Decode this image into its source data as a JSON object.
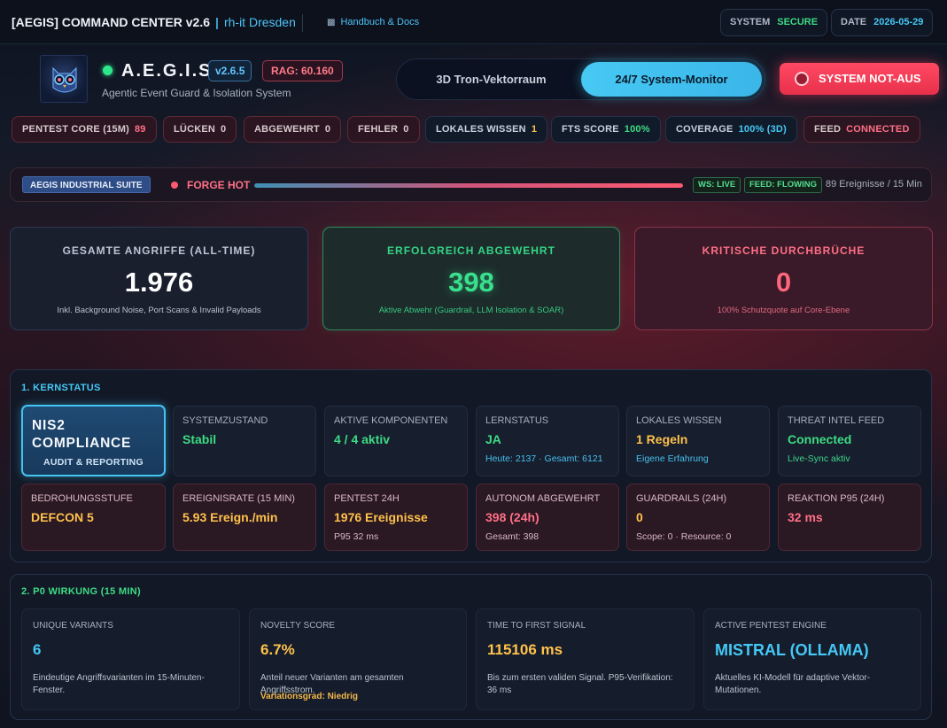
{
  "topbar": {
    "title": "[AEGIS] COMMAND CENTER v2.6",
    "separator": "|",
    "org": "rh-it Dresden",
    "docs_icon": "book-icon",
    "docs_label": "Handbuch & Docs",
    "system_label": "SYSTEM",
    "system_value": "SECURE",
    "date_label": "DATE",
    "date_value": "2026-05-29"
  },
  "header": {
    "logo": "owl-logo",
    "brand": "A.E.G.I.S.",
    "subtitle": "Agentic Event Guard & Isolation System",
    "version": "v2.6.5",
    "rag": "RAG: 60.160",
    "modes": [
      "3D Tron-Vektorraum",
      "24/7 System-Monitor"
    ],
    "active_mode": "24/7 System-Monitor",
    "emergency_label": "SYSTEM NOT-AUS"
  },
  "chips": [
    {
      "label": "PENTEST CORE (15M)",
      "value": "89"
    },
    {
      "label": "LÜCKEN",
      "value": "0"
    },
    {
      "label": "ABGEWEHRT",
      "value": "0"
    },
    {
      "label": "FEHLER",
      "value": "0"
    },
    {
      "label": "LOKALES WISSEN",
      "value": "1"
    },
    {
      "label": "FTS SCORE",
      "value": "100%"
    },
    {
      "label": "COVERAGE",
      "value": "100% (3D)"
    },
    {
      "label": "FEED",
      "value": "CONNECTED"
    }
  ],
  "suite": {
    "tag": "AEGIS INDUSTRIAL SUITE",
    "status": "FORGE HOT",
    "progress": 1.0,
    "ws": "WS: LIVE",
    "feed": "FEED: FLOWING",
    "events": "89 Ereignisse / 15 Min"
  },
  "stats": [
    {
      "title": "GESAMTE ANGRIFFE (ALL-TIME)",
      "value": "1.976",
      "sub": "Inkl. Background Noise, Port Scans & Invalid Payloads"
    },
    {
      "title": "ERFOLGREICH ABGEWEHRT",
      "value": "398",
      "sub": "Aktive Abwehr (Guardrail, LLM Isolation & SOAR)"
    },
    {
      "title": "KRITISCHE DURCHBRÜCHE",
      "value": "0",
      "sub": "100% Schutzquote auf Core-Ebene"
    }
  ],
  "kernstatus": {
    "title": "1. KERNSTATUS",
    "nis2_title": "NIS2 COMPLIANCE",
    "nis2_sub": "AUDIT & REPORTING",
    "row1": [
      {
        "label": "SYSTEMZUSTAND",
        "value": "Stabil",
        "sub": ""
      },
      {
        "label": "AKTIVE KOMPONENTEN",
        "value": "4 / 4 aktiv",
        "sub": ""
      },
      {
        "label": "LERNSTATUS",
        "value": "JA",
        "sub": "Heute: 2137 · Gesamt: 6121"
      },
      {
        "label": "LOKALES WISSEN",
        "value": "1 Regeln",
        "sub": "Eigene Erfahrung"
      },
      {
        "label": "THREAT INTEL FEED",
        "value": "Connected",
        "sub": "Live-Sync aktiv"
      }
    ],
    "row2": [
      {
        "label": "BEDROHUNGSSTUFE",
        "value": "DEFCON 5",
        "sub": ""
      },
      {
        "label": "EREIGNISRATE (15 MIN)",
        "value": "5.93 Ereign./min",
        "sub": ""
      },
      {
        "label": "PENTEST 24H",
        "value": "1976 Ereignisse",
        "sub": "P95 32 ms"
      },
      {
        "label": "AUTONOM ABGEWEHRT",
        "value": "398 (24h)",
        "sub": "Gesamt: 398"
      },
      {
        "label": "GUARDRAILS (24H)",
        "value": "0",
        "sub": "Scope: 0 · Resource: 0"
      },
      {
        "label": "REAKTION P95 (24H)",
        "value": "32 ms",
        "sub": ""
      }
    ]
  },
  "wirkung": {
    "title": "2. P0 WIRKUNG (15 MIN)",
    "tiles": [
      {
        "label": "UNIQUE VARIANTS",
        "value": "6",
        "desc": "Eindeutige Angriffsvarianten im 15-Minuten-Fenster.",
        "extra": ""
      },
      {
        "label": "NOVELTY SCORE",
        "value": "6.7%",
        "desc": "Anteil neuer Varianten am gesamten Angriffsstrom.",
        "extra": "Variationsgrad: Niedrig"
      },
      {
        "label": "TIME TO FIRST SIGNAL",
        "value": "115106 ms",
        "desc": "Bis zum ersten validen Signal. P95-Verifikation: 36 ms",
        "extra": ""
      },
      {
        "label": "ACTIVE PENTEST ENGINE",
        "value": "MISTRAL (OLLAMA)",
        "desc": "Aktuelles KI-Modell für adaptive Vektor-Mutationen.",
        "extra": ""
      }
    ]
  },
  "colors": {
    "accent": "#45c8f5",
    "ok": "#3ddc84",
    "warn": "#ffc24b",
    "danger": "#ff6f86"
  }
}
